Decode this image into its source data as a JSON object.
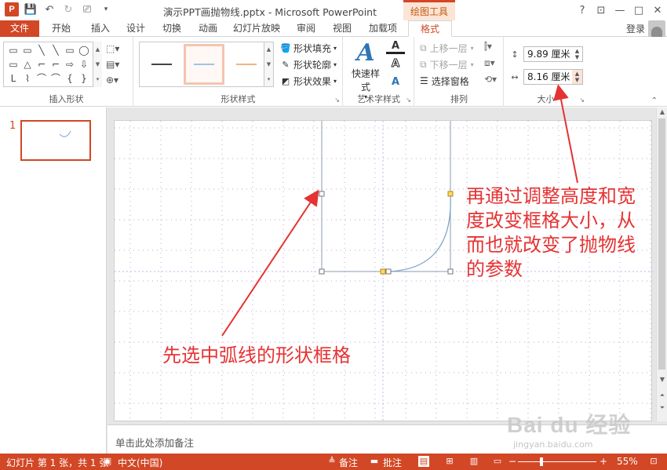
{
  "app": {
    "logo": "P",
    "title": "演示PPT画抛物线.pptx - Microsoft PowerPoint",
    "context_tab": "绘图工具",
    "window_buttons": [
      "?",
      "□",
      "—",
      "□",
      "✕"
    ]
  },
  "quick_access": {
    "icons": [
      "save-icon",
      "undo-icon",
      "redo-icon",
      "present-icon",
      "customize-icon"
    ]
  },
  "tabs": [
    {
      "label": "文件",
      "active": false
    },
    {
      "label": "开始",
      "active": false
    },
    {
      "label": "插入",
      "active": false
    },
    {
      "label": "设计",
      "active": false
    },
    {
      "label": "切换",
      "active": false
    },
    {
      "label": "动画",
      "active": false
    },
    {
      "label": "幻灯片放映",
      "active": false
    },
    {
      "label": "审阅",
      "active": false
    },
    {
      "label": "视图",
      "active": false
    },
    {
      "label": "加载项",
      "active": false
    },
    {
      "label": "格式",
      "active": true
    }
  ],
  "login_label": "登录",
  "ribbon": {
    "insert_shapes": {
      "label": "插入形状",
      "shapes": [
        "▭",
        "▭",
        "╲",
        "╲",
        "▭",
        "◯",
        "▭",
        "△",
        "⌐",
        "⌐",
        "⇨",
        "⇩",
        "ᒪ",
        "⌇",
        "⌒",
        "⌒",
        "{",
        "}"
      ]
    },
    "shape_styles": {
      "label": "形状样式",
      "fill": "形状填充",
      "outline": "形状轮廓",
      "effects": "形状效果",
      "line_colors": [
        "#444444",
        "#9dc3e6",
        "#f4b183"
      ]
    },
    "wordart": {
      "label": "艺术字样式",
      "quick_styles": "快速样式"
    },
    "arrange": {
      "label": "排列",
      "bring_forward": "上移一层",
      "send_backward": "下移一层",
      "selection_pane": "选择窗格"
    },
    "size": {
      "label": "大小",
      "height": "9.89 厘米",
      "width": "8.16 厘米"
    }
  },
  "thumbnail": {
    "number": "1"
  },
  "notes_placeholder": "单击此处添加备注",
  "annotations": {
    "select_frame": "先选中弧线的形状框格",
    "adjust_size": [
      "再通过调整高度和宽",
      "度改变框格大小，从",
      "而也就改变了抛物线",
      "的参数"
    ]
  },
  "watermark": {
    "text": "Bai du 经验",
    "url": "jingyan.baidu.com"
  },
  "status": {
    "slide_info": "幻灯片 第 1 张，共 1 张",
    "language": "中文(中国)",
    "notes": "备注",
    "comments": "批注",
    "zoom": "55%"
  },
  "colors": {
    "accent": "#d24726",
    "annotation": "#e53333",
    "arc": "#7fa6c9"
  }
}
